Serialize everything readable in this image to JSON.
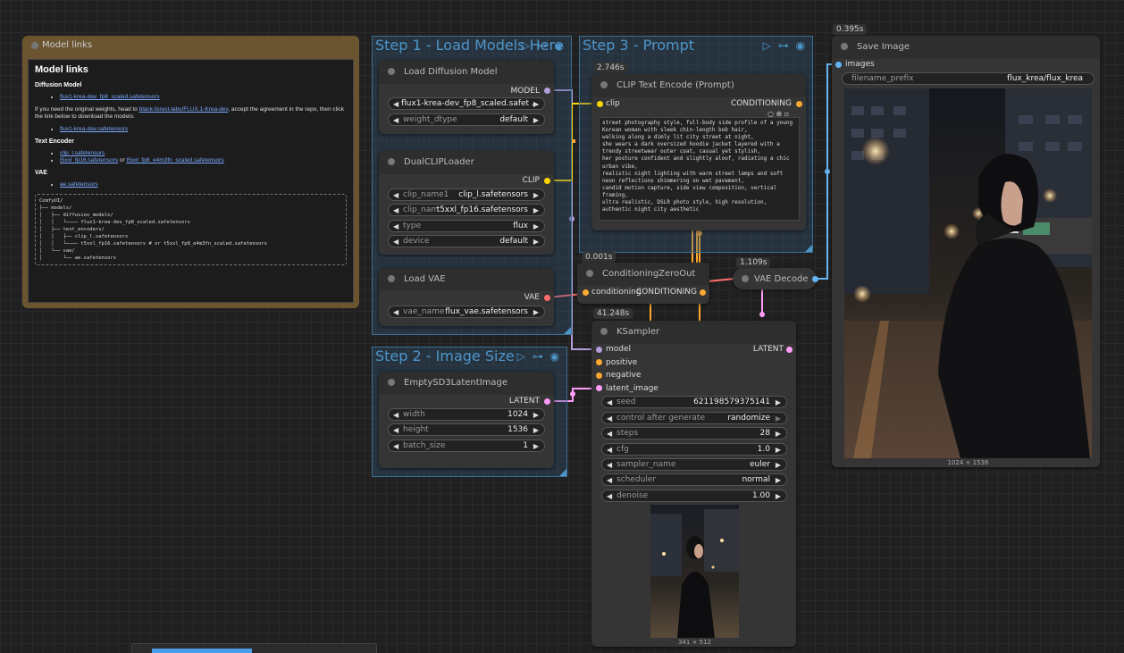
{
  "groups": {
    "step1": {
      "title": "Step 1 - Load Models Here"
    },
    "step2": {
      "title": "Step 2 - Image Size"
    },
    "step3": {
      "title": "Step 3 - Prompt"
    }
  },
  "group_icons": "▷ ⊶ ◉",
  "note": {
    "title": "Model links",
    "heading": "Model links",
    "diffusion_model_heading": "Diffusion Model",
    "diffusion_link": "flux1-krea-dev_fp8_scaled.safetensors",
    "original_text_1": "If you need the original weights, head to ",
    "original_link": "black-forest-labs/FLUX.1-Krea-dev",
    "original_text_2": ", accept the agreement in the repo, then click the link below to download the models:",
    "original_model_link": "flux1-krea-dev.safetensors",
    "text_encoder_heading": "Text Encoder",
    "clip_l_link": "clip_l.safetensors",
    "t5_fp16_link": "t5xxl_fp16.safetensors",
    "or_text": " or ",
    "t5_fp8_link": "t5xxl_fp8_e4m3fn_scaled.safetensors",
    "vae_heading": "VAE",
    "vae_link": "ae.safetensors",
    "tree": "ComfyUI/\n├── models/\n│   ├── diffusion_models/\n│   │   └──── flux1-krea-dev_fp8_scaled.safetensors\n│   ├── text_encoders/\n│   │   ├── clip_l.safetensors\n│   │   └──── t5xxl_fp16.safetensors # or t5xxl_fp8_e4m3fn_scaled.safetensors\n│   └── vae/\n│       └── ae.safetensors"
  },
  "load_diffusion": {
    "title": "Load Diffusion Model",
    "output": "MODEL",
    "unet_value": "flux1-krea-dev_fp8_scaled.safet ...",
    "weight_label": "weight_dtype",
    "weight_value": "default"
  },
  "dual_clip": {
    "title": "DualCLIPLoader",
    "output": "CLIP",
    "clip_name1_label": "clip_name1",
    "clip_name1_value": "clip_l.safetensors",
    "clip_name2_label": "clip_nam ...",
    "clip_name2_value": "t5xxl_fp16.safetensors",
    "type_label": "type",
    "type_value": "flux",
    "device_label": "device",
    "device_value": "default"
  },
  "load_vae": {
    "title": "Load VAE",
    "output": "VAE",
    "vae_label": "vae_name",
    "vae_value": "flux_vae.safetensors"
  },
  "latent": {
    "title": "EmptySD3LatentImage",
    "output": "LATENT",
    "width_label": "width",
    "width_value": "1024",
    "height_label": "height",
    "height_value": "1536",
    "batch_label": "batch_size",
    "batch_value": "1"
  },
  "clip_encode": {
    "timing": "2.746s",
    "title": "CLIP Text Encode (Prompt)",
    "input": "clip",
    "output": "CONDITIONING",
    "text": "street photography style, full-body side profile of a young\nKorean woman with sleek chin-length bob hair,\nwalking along a dimly lit city street at night,\nshe wears a dark oversized hoodie jacket layered with a\ntrendy streetwear outer coat, casual yet stylish,\nher posture confident and slightly aloof, radiating a chic\nurban vibe,\nrealistic night lighting with warm street lamps and soft\nneon reflections shimmering on wet pavement,\ncandid motion capture, side view composition, vertical\nframing,\nultra realistic, DSLR photo style, high resolution,\nauthentic night city aesthetic"
  },
  "zero_out": {
    "timing": "0.001s",
    "title": "ConditioningZeroOut",
    "input": "conditioning",
    "output": "CONDITIONING"
  },
  "vae_decode": {
    "timing": "1.109s",
    "title": "VAE Decode"
  },
  "ksampler": {
    "timing": "41.248s",
    "title": "KSampler",
    "inputs": [
      "model",
      "positive",
      "negative",
      "latent_image"
    ],
    "output": "LATENT",
    "widgets": [
      {
        "label": "seed",
        "value": "621198579375141"
      },
      {
        "label": "control after generate",
        "value": "randomize"
      },
      {
        "label": "steps",
        "value": "28"
      },
      {
        "label": "cfg",
        "value": "1.0"
      },
      {
        "label": "sampler_name",
        "value": "euler"
      },
      {
        "label": "scheduler",
        "value": "normal"
      },
      {
        "label": "denoise",
        "value": "1.00"
      }
    ],
    "preview_caption": "341 × 512"
  },
  "save_image": {
    "timing": "0.395s",
    "title": "Save Image",
    "input": "images",
    "prefix_label": "filename_prefix",
    "prefix_value": "flux_krea/flux_krea",
    "caption": "1024 × 1536"
  },
  "colors": {
    "model": "#b39ddb",
    "clip": "#ffd500",
    "conditioning": "#ffa931",
    "vae": "#ff6e6e",
    "latent": "#ff9cf9",
    "image": "#64b5f6"
  }
}
